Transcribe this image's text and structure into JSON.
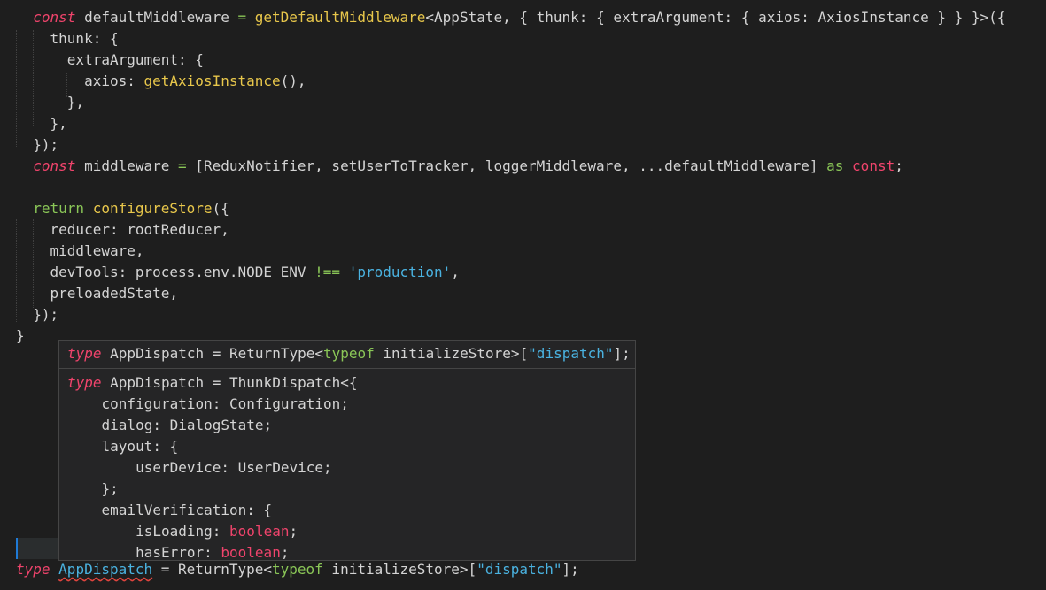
{
  "code": {
    "l1": {
      "kw": "const",
      "a": " defaultMiddleware ",
      "eq": "=",
      "b": " ",
      "fn": "getDefaultMiddleware",
      "c": "<AppState, { thunk: { extraArgument: { axios: AxiosInstance } } }>({"
    },
    "l2": "thunk: {",
    "l3": "extraArgument: {",
    "l4": {
      "a": "axios: ",
      "fn": "getAxiosInstance",
      "b": "(),"
    },
    "l5": "},",
    "l6": "},",
    "l7": "});",
    "l8": {
      "kw": "const",
      "a": " middleware ",
      "eq": "=",
      "b": " [ReduxNotifier, setUserToTracker, loggerMiddleware, ...defaultMiddleware] ",
      "as": "as",
      "sp": " ",
      "const2": "const",
      "end": ";"
    },
    "l10": {
      "kw": "return",
      "sp": " ",
      "fn": "configureStore",
      "b": "({"
    },
    "l11": "reducer: rootReducer,",
    "l12": "middleware,",
    "l13": {
      "a": "devTools: process.env.NODE_ENV ",
      "op": "!==",
      "sp": " ",
      "str": "'production'",
      "b": ","
    },
    "l14": "preloadedState,",
    "l15": "});",
    "l16": "}",
    "last": {
      "kw": "type",
      "sp": " ",
      "name": "AppDispatch",
      "eq": " = ReturnType<",
      "typeof": "typeof",
      "b": " initializeStore>[",
      "str": "\"dispatch\"",
      "c": "];"
    }
  },
  "tooltip": {
    "header": {
      "kw": "type",
      "a": " AppDispatch = ReturnType<",
      "typeof": "typeof",
      "b": " initializeStore>[",
      "str": "\"dispatch\"",
      "c": "];"
    },
    "body": {
      "l1": {
        "kw": "type",
        "a": " AppDispatch = ThunkDispatch<{"
      },
      "l2": "    configuration: Configuration;",
      "l3": "    dialog: DialogState;",
      "l4": "    layout: {",
      "l5": "        userDevice: UserDevice;",
      "l6": "    };",
      "l7": "    emailVerification: {",
      "l8": {
        "a": "        isLoading: ",
        "bool": "boolean",
        "b": ";"
      },
      "l9": {
        "a": "        hasError: ",
        "bool": "boolean",
        "b": ";"
      }
    }
  },
  "colors": {
    "background": "#1e1e1e",
    "keyword": "#f0446c",
    "function": "#e8c74b",
    "string": "#4ab2e0",
    "operator": "#8ac657",
    "cursor": "#1f7ad6"
  }
}
